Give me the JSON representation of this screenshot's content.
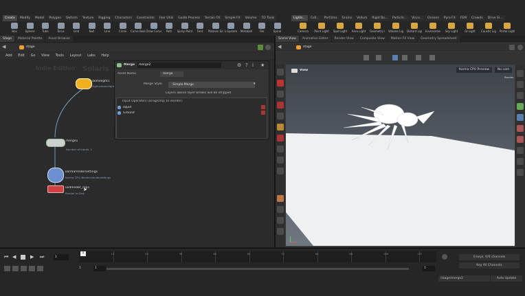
{
  "shelf_tabs_left": [
    "Create",
    "Modify",
    "Model",
    "Polygon",
    "Deform",
    "Texture",
    "Rigging",
    "Characters",
    "Constraints",
    "Hair Utils",
    "Guide Process",
    "Terrain FX",
    "Simple FX",
    "Volume",
    "TD Tools"
  ],
  "shelf_tabs_right": [
    "Lights...",
    "Coll...",
    "Particles",
    "Grains",
    "Vellum",
    "Rigid Bo...",
    "Particle...",
    "Visco...",
    "Oceans",
    "Pyro FX",
    "FEM",
    "Crowds",
    "Drive Si..."
  ],
  "tools_left": [
    "Box",
    "Sphere",
    "Tube",
    "Torus",
    "Grid",
    "Null",
    "Line",
    "Circle",
    "Curve Bezier",
    "Draw Curve",
    "Path",
    "Spray Paint",
    "Font",
    "Platonic Solids",
    "L-System",
    "Metaball",
    "File",
    "Spiral"
  ],
  "tools_right": [
    "Camera",
    "Point Light",
    "Spot Light",
    "Area Light",
    "Geometry Light",
    "Volume Light",
    "Distant Light",
    "Environment Light",
    "Sky Light",
    "GI Light",
    "Caustic Light",
    "Portal Light"
  ],
  "left_pane": {
    "tabs": [
      "Stage",
      "Material Palette",
      "Asset Browser"
    ],
    "path": "stage",
    "menu": [
      "Add",
      "Edit",
      "Go",
      "View",
      "Tools",
      "Layout",
      "Labs",
      "Help"
    ],
    "watermark_edition": "Indie Edition",
    "watermark_product": "Solaris",
    "nodes": [
      {
        "name": "domelight1",
        "sub": "/lights/domelight1"
      },
      {
        "name": "merge1",
        "sub": "Number of inputs: 2"
      },
      {
        "name": "karmarendersettings",
        "sub": "Karma CPU\n/Render/rendersettings"
      },
      {
        "name": "usdrender_rop1",
        "sub": "Render to Disk"
      }
    ]
  },
  "param_panel": {
    "node_type": "Merge",
    "node_name": "merge2",
    "asset_name_label": "Asset Name",
    "asset_name_value": "merge",
    "merge_style_label": "Merge Style",
    "merge_style_value": "Simple Merge",
    "note": "Layers above layer breaks will be stripped",
    "inputs_header": "Input Operators (Drag/Drop to reorder)",
    "inputs": [
      "squid",
      "Ground"
    ]
  },
  "right_pane": {
    "tabs": [
      "Scene View",
      "Animation Editor",
      "Render View",
      "Composite View",
      "Motion FX View",
      "Geometry Spreadsheet"
    ],
    "path": "stage",
    "view_label": "View",
    "camera_label": "Karma CPU Preview",
    "cam_menu": "No cam",
    "render_note": "Render"
  },
  "timeline": {
    "frame": "1",
    "start": "1",
    "end": "1",
    "ticks": [
      "12",
      "24",
      "36",
      "48",
      "60",
      "72",
      "84",
      "96",
      "108",
      "120"
    ],
    "keys_label": "0 keys, 0/0 channels",
    "key_all_label": "Key All Channels",
    "status_path": "/stage/merge2",
    "update_mode": "Auto Update"
  },
  "colors": {
    "accent": "#f0a030",
    "node_outline": "#8fbf8f",
    "stage_bg": "#eef0f1"
  }
}
